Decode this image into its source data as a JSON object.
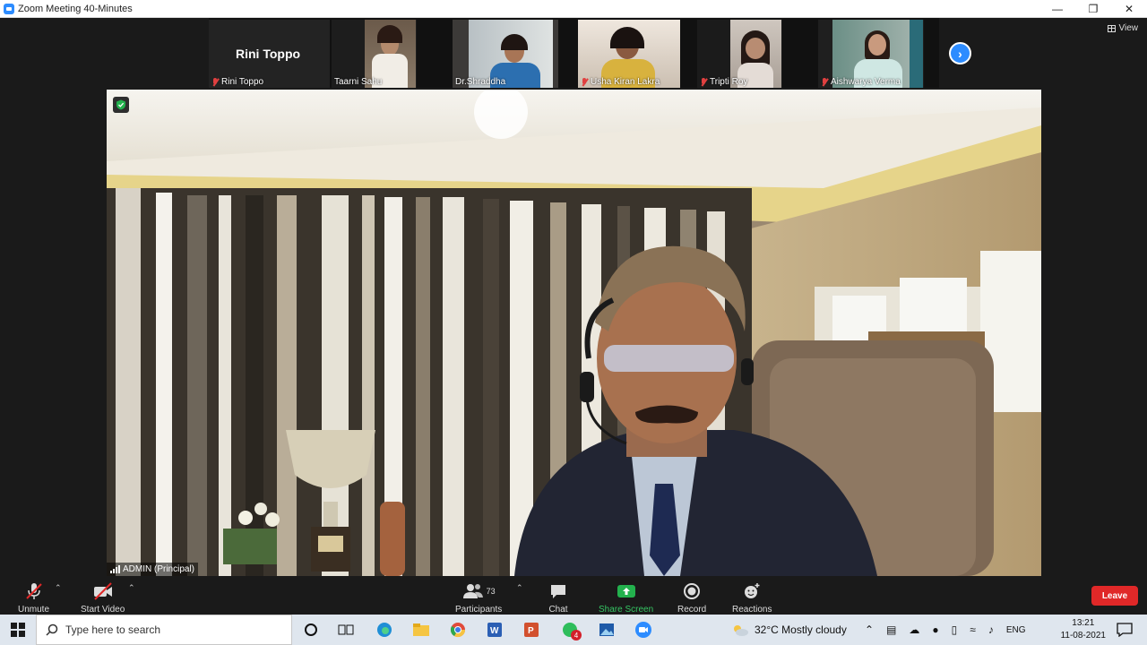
{
  "window": {
    "title": "Zoom Meeting 40-Minutes"
  },
  "view_label": "View",
  "participants_strip": [
    {
      "name": "Rini Toppo",
      "muted": true,
      "video": false
    },
    {
      "name": "Taarni Sahu",
      "muted": false,
      "video": true
    },
    {
      "name": "Dr.Shraddha",
      "muted": false,
      "video": true
    },
    {
      "name": "Usha Kiran Lakra",
      "muted": true,
      "video": true
    },
    {
      "name": "Tripti Roy",
      "muted": true,
      "video": true
    },
    {
      "name": "Aishwarya Verma",
      "muted": true,
      "video": true
    }
  ],
  "rini_big_name": "Rini Toppo",
  "active_speaker": {
    "name": "ADMIN (Principal)"
  },
  "toolbar": {
    "unmute": "Unmute",
    "start_video": "Start Video",
    "participants": "Participants",
    "participants_count": "73",
    "chat": "Chat",
    "share_screen": "Share Screen",
    "record": "Record",
    "reactions": "Reactions",
    "leave": "Leave"
  },
  "taskbar": {
    "search_placeholder": "Type here to search",
    "whatsapp_badge": "4",
    "weather": "32°C  Mostly cloudy",
    "language": "ENG",
    "time": "13:21",
    "date": "11-08-2021"
  },
  "colors": {
    "zoom_blue": "#2d8cff",
    "share_green": "#23b14d",
    "leave_red": "#e02828"
  }
}
